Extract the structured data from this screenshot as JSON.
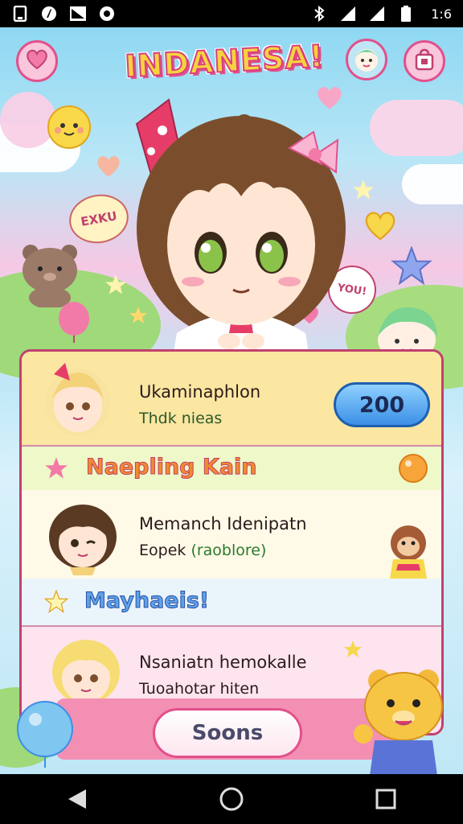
{
  "status_bar": {
    "time": "1:6",
    "icons": [
      "notification-icon",
      "circle-app-icon",
      "photo-icon",
      "chat-icon",
      "bluetooth-icon",
      "signal-icon",
      "wifi-signal-icon",
      "battery-icon"
    ]
  },
  "game": {
    "title": "INDANESA!",
    "left_button_icon": "heart-icon",
    "right_buttons": [
      "friend-avatar-icon",
      "shop-bag-icon"
    ],
    "sign_text": "EXKU",
    "badge_text": "YOU!",
    "colors": {
      "accent": "#e2508c",
      "title_fill": "#f7d23e",
      "score_button": "#3b8fe6",
      "panel_border": "#c0416f"
    }
  },
  "list": {
    "entries": [
      {
        "name": "Ukaminaphlon",
        "subtitle": "Thdk nieas",
        "score": "200"
      },
      {
        "name": "Memanch Idenipatn",
        "subtitle": "Eopek",
        "subtitle_extra": "(raoblore)"
      },
      {
        "name": "Nsaniatn hemokalle",
        "subtitle": "Tuoahotar hiten"
      }
    ],
    "sections": [
      {
        "title": "Naepling Kain"
      },
      {
        "title": "Mayhaeis!"
      }
    ]
  },
  "footer": {
    "soon_label": "Soons"
  },
  "nav_bar": {
    "buttons": [
      "back-icon",
      "home-icon",
      "recents-icon"
    ]
  }
}
